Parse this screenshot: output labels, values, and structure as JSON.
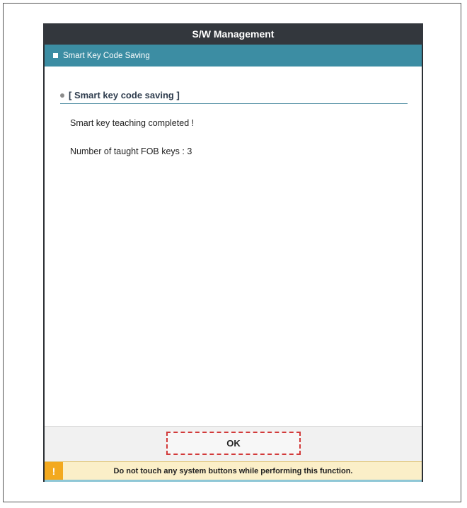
{
  "window": {
    "title": "S/W Management"
  },
  "section": {
    "icon": "square-icon",
    "title": "Smart Key Code Saving"
  },
  "content": {
    "bullet_icon": "bullet-dot-icon",
    "heading": "[ Smart key code saving ]",
    "message_1": "Smart key teaching completed !",
    "message_2": "Number of taught FOB keys : 3"
  },
  "actions": {
    "ok_label": "OK"
  },
  "warning": {
    "icon": "exclamation-icon",
    "icon_glyph": "!",
    "text": "Do not touch any system buttons while performing this function."
  },
  "colors": {
    "title_bar": "#33373d",
    "section_bar": "#3c8da3",
    "ok_highlight": "#d23a3a",
    "warning_bg": "#fbefc8",
    "warning_icon": "#f3a91e"
  }
}
